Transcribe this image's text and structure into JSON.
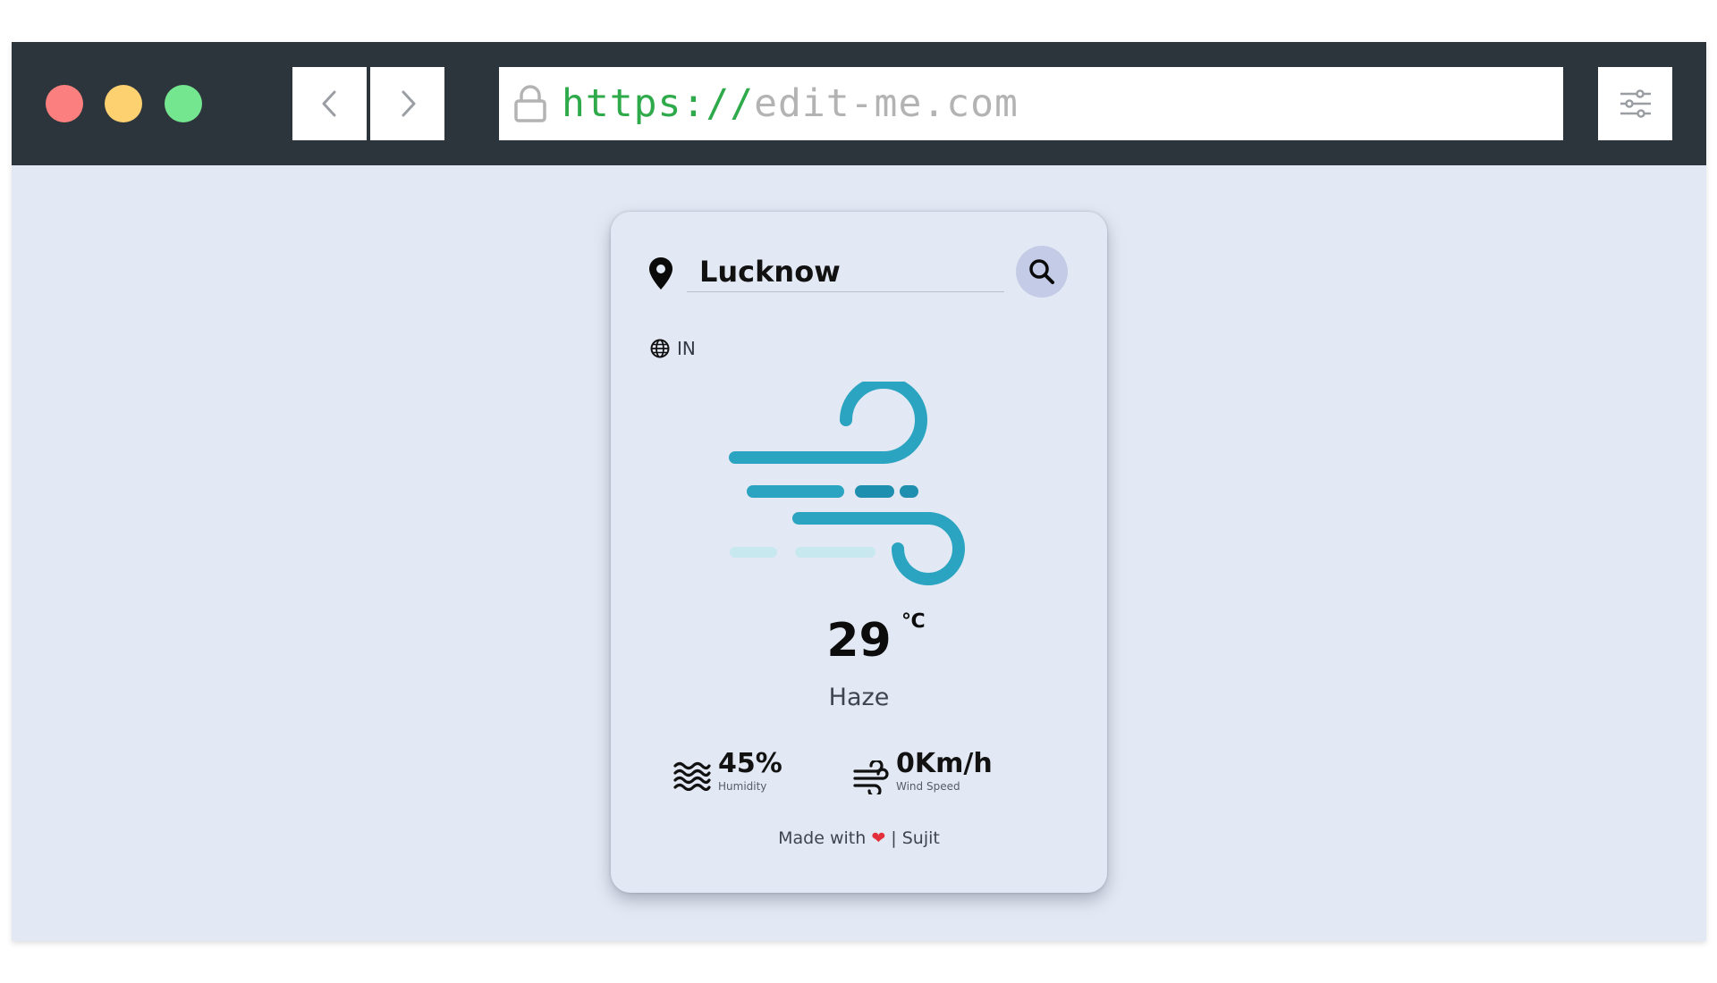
{
  "browser": {
    "url_scheme": "https://",
    "url_host": "edit-me.com",
    "icons": [
      "back-icon",
      "forward-icon",
      "lock-icon",
      "settings-sliders-icon"
    ]
  },
  "weather": {
    "city": "Lucknow",
    "country": "IN",
    "temperature": "29",
    "unit": "℃",
    "condition": "Haze",
    "humidity_value": "45%",
    "humidity_label": "Humidity",
    "wind_value": "0Km/h",
    "wind_label": "Wind Speed",
    "footer_prefix": "Made with",
    "footer_heart": "❤",
    "footer_suffix": "| Sujit",
    "icons": [
      "location-pin-icon",
      "search-icon",
      "globe-icon",
      "wind-weather-icon",
      "humidity-icon",
      "wind-icon"
    ]
  },
  "colors": {
    "titlebar": "#2d353c",
    "page_bg": "#e3e9f4",
    "url_scheme": "#2eaa4a",
    "search_button": "#c3cbe6",
    "wind_icon": "#2aa4c0",
    "heart": "#e2313c"
  }
}
